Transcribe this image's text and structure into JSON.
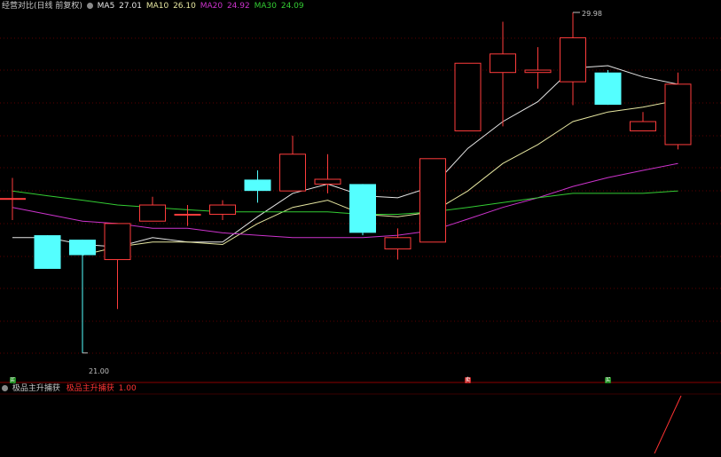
{
  "legend": {
    "title": "经营对比(日线 前复权)",
    "items": [
      {
        "name": "MA5",
        "value": "27.01",
        "color": "#e6e6e6"
      },
      {
        "name": "MA10",
        "value": "26.10",
        "color": "#e6e6a0"
      },
      {
        "name": "MA20",
        "value": "24.92",
        "color": "#cc33cc"
      },
      {
        "name": "MA30",
        "value": "24.09",
        "color": "#33cc33"
      }
    ]
  },
  "annotations": {
    "high": "29.98",
    "low": "21.00"
  },
  "sub_legend": {
    "name": "极品主升捕获",
    "series_label": "极品主升捕获",
    "value": "1.00",
    "series_color": "#ff3333"
  },
  "markers": [
    {
      "label": "买",
      "index": 0,
      "color": "#1e8a1e"
    },
    {
      "label": "卖",
      "index": 13,
      "color": "#c02020"
    },
    {
      "label": "买",
      "index": 17,
      "color": "#1e8a1e"
    }
  ],
  "colors": {
    "up": "#ff3c3c",
    "down": "#54ffff",
    "grid": "#5a0000"
  },
  "chart_data": {
    "type": "candlestick",
    "ylim": [
      20.27,
      30.92
    ],
    "candles": [
      {
        "open": 25.5,
        "close": 25.5,
        "high": 26.1,
        "low": 24.87
      },
      {
        "open": 24.43,
        "close": 23.45,
        "high": 24.43,
        "low": 23.45
      },
      {
        "open": 24.3,
        "close": 23.85,
        "high": 24.3,
        "low": 21.0
      },
      {
        "open": 23.72,
        "close": 24.77,
        "high": 24.77,
        "low": 22.28
      },
      {
        "open": 24.84,
        "close": 25.31,
        "high": 25.55,
        "low": 24.84
      },
      {
        "open": 25.04,
        "close": 25.04,
        "high": 25.31,
        "low": 24.7
      },
      {
        "open": 25.04,
        "close": 25.31,
        "high": 25.45,
        "low": 24.87
      },
      {
        "open": 26.05,
        "close": 25.72,
        "high": 26.32,
        "low": 25.38
      },
      {
        "open": 25.72,
        "close": 26.79,
        "high": 27.33,
        "low": 25.72
      },
      {
        "open": 25.92,
        "close": 26.06,
        "high": 26.79,
        "low": 25.65
      },
      {
        "open": 25.92,
        "close": 24.5,
        "high": 25.92,
        "low": 24.43
      },
      {
        "open": 24.03,
        "close": 24.36,
        "high": 24.63,
        "low": 23.72
      },
      {
        "open": 24.23,
        "close": 26.66,
        "high": 26.66,
        "low": 24.23
      },
      {
        "open": 27.47,
        "close": 29.44,
        "high": 29.44,
        "low": 27.47
      },
      {
        "open": 29.17,
        "close": 29.71,
        "high": 30.65,
        "low": 27.6
      },
      {
        "open": 29.17,
        "close": 29.24,
        "high": 29.91,
        "low": 28.7
      },
      {
        "open": 28.9,
        "close": 30.18,
        "high": 30.92,
        "low": 28.22
      },
      {
        "open": 29.17,
        "close": 28.23,
        "high": 29.24,
        "low": 28.23
      },
      {
        "open": 27.47,
        "close": 27.74,
        "high": 28.02,
        "low": 27.47
      },
      {
        "open": 27.07,
        "close": 28.83,
        "high": 29.17,
        "low": 26.93
      }
    ],
    "ma_series": [
      {
        "name": "MA5",
        "color": "#e6e6e6",
        "values": [
          24.36,
          24.36,
          24.16,
          24.09,
          24.36,
          24.23,
          24.23,
          24.97,
          25.65,
          25.92,
          25.58,
          25.52,
          25.85,
          26.96,
          27.74,
          28.32,
          29.3,
          29.37,
          29.04,
          28.83
        ]
      },
      {
        "name": "MA10",
        "color": "#e6e6a0",
        "values": [
          null,
          null,
          23.85,
          24.09,
          24.23,
          24.23,
          24.16,
          24.77,
          25.24,
          25.45,
          25.04,
          24.97,
          25.11,
          25.72,
          26.52,
          27.07,
          27.74,
          28.02,
          28.16,
          28.36
        ]
      },
      {
        "name": "MA20",
        "color": "#cc33cc",
        "values": [
          25.24,
          25.04,
          24.84,
          24.77,
          24.63,
          24.63,
          24.5,
          24.43,
          24.36,
          24.36,
          24.36,
          24.43,
          24.57,
          24.9,
          25.24,
          25.52,
          25.85,
          26.11,
          26.32,
          26.52
        ]
      },
      {
        "name": "MA30",
        "color": "#33cc33",
        "values": [
          25.72,
          25.58,
          25.45,
          25.31,
          25.24,
          25.17,
          25.11,
          25.11,
          25.11,
          25.11,
          25.04,
          25.04,
          25.11,
          25.24,
          25.38,
          25.52,
          25.65,
          25.65,
          25.65,
          25.72
        ]
      }
    ]
  }
}
